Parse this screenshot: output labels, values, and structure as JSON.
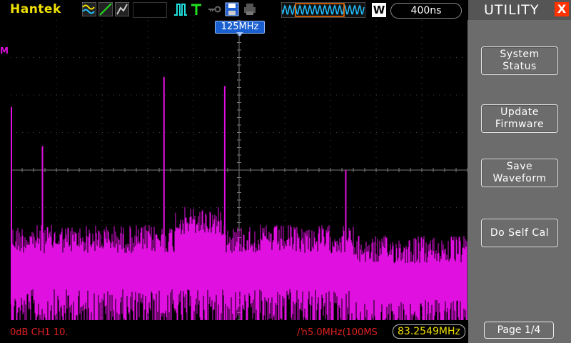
{
  "brand": "Hantek",
  "toolbar": {
    "mode_badge": "W",
    "timebase": "400ns"
  },
  "marker": {
    "label": "M",
    "freq_tag": "125MHz"
  },
  "status": {
    "channel": "0dB  CH1  10.",
    "fft": "/ŉ5.0MHz(100MS",
    "freq_readout": "83.2549MHz"
  },
  "menu": {
    "title": "UTILITY",
    "close_label": "X",
    "buttons": [
      {
        "line1": "System",
        "line2": "Status"
      },
      {
        "line1": "Update",
        "line2": "Firmware"
      },
      {
        "line1": "Save",
        "line2": "Waveform"
      },
      {
        "line1": "Do Self Cal",
        "line2": ""
      }
    ],
    "page": "Page 1/4"
  },
  "colors": {
    "trace": "#e010e0",
    "brand": "#f0e000",
    "grid": "#7a7a7a",
    "close": "#ff3300"
  },
  "chart_data": {
    "type": "line",
    "peaks": [
      {
        "x": 0.0,
        "y": 0.71
      },
      {
        "x": 0.068,
        "y": 0.58
      },
      {
        "x": 0.334,
        "y": 0.81
      },
      {
        "x": 0.467,
        "y": 0.78
      },
      {
        "x": 0.732,
        "y": 0.5
      }
    ],
    "noise_floor": 0.27
  }
}
